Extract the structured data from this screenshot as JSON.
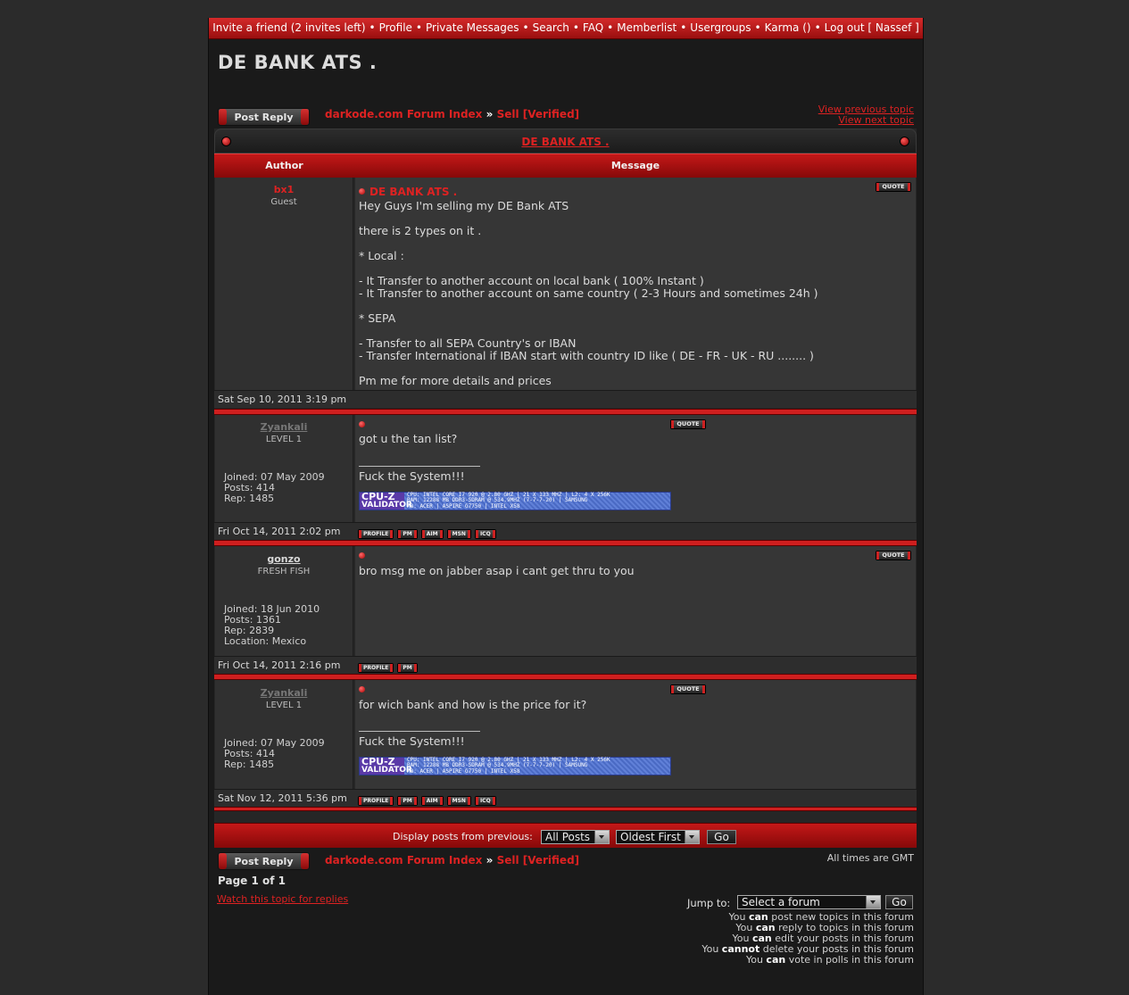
{
  "topnav": {
    "items": [
      "Invite a friend (2 invites left)",
      "Profile",
      "Private Messages",
      "Search",
      "FAQ",
      "Memberlist",
      "Usergroups",
      "Karma ()",
      "Log out [ Nassef ]"
    ],
    "separator": "•"
  },
  "page_title": "DE BANK ATS .",
  "post_reply_label": "Post Reply",
  "breadcrumb": {
    "forum_index": "darkode.com Forum Index",
    "sep": "»",
    "section": "Sell [Verified]"
  },
  "topic_nav": {
    "prev": "View previous topic",
    "next": "View next topic"
  },
  "table": {
    "title": "DE BANK ATS .",
    "col_author": "Author",
    "col_message": "Message"
  },
  "quote_label": "QUOTE",
  "posts": [
    {
      "author": "bx1",
      "rank": "Guest",
      "subject": "DE BANK ATS .",
      "body": "Hey Guys I'm selling my DE Bank ATS\n\nthere is 2 types on it .\n\n* Local :\n\n- It Transfer to another account on local bank ( 100% Instant )\n- It Transfer to another account on same country ( 2-3 Hours and sometimes 24h )\n\n* SEPA\n\n- Transfer to all SEPA Country's or IBAN\n- Transfer International if IBAN start with country ID like ( DE - FR - UK - RU ........ )\n\nPm me for more details and prices",
      "date": "Sat Sep 10, 2011 3:19 pm"
    },
    {
      "author": "Zyankali",
      "rank": "LEVEL 1",
      "info": [
        "Joined: 07 May 2009",
        "Posts: 414",
        "Rep: 1485"
      ],
      "body": "got u the tan list?",
      "signature": "Fuck the System!!!",
      "date": "Fri Oct 14, 2011 2:02 pm",
      "buttons": [
        "PROFILE",
        "PM",
        "AIM",
        "MSN",
        "ICQ"
      ]
    },
    {
      "author": "gonzo",
      "rank": "FRESH FISH",
      "info": [
        "Joined: 18 Jun 2010",
        "Posts: 1361",
        "Rep: 2839",
        "Location: Mexico"
      ],
      "body": "bro msg me on jabber asap i cant get thru to you",
      "date": "Fri Oct 14, 2011 2:16 pm",
      "buttons": [
        "PROFILE",
        "PM"
      ]
    },
    {
      "author": "Zyankali",
      "rank": "LEVEL 1",
      "info": [
        "Joined: 07 May 2009",
        "Posts: 414",
        "Rep: 1485"
      ],
      "body": "for wich bank and how is the price for it?",
      "signature": "Fuck the System!!!",
      "date": "Sat Nov 12, 2011 5:36 pm",
      "buttons": [
        "PROFILE",
        "PM",
        "AIM",
        "MSN",
        "ICQ"
      ]
    }
  ],
  "cpuz": {
    "logo_top": "CPU-Z",
    "logo_bottom": "VALIDATOR",
    "lines": [
      "CPU: INTEL CORE I7 920 @ 2.80 GHZ | 21 X 133 MHZ | L2: 4 X 256K",
      "RAM: 12288 MB DDR3-SDRAM @ 534.9MHZ (7-7-7-20) | SAMSUNG",
      "MB: ACER | ASPIRE G7750 | INTEL X58"
    ]
  },
  "display": {
    "label": "Display posts from previous:",
    "filter": "All Posts",
    "order": "Oldest First",
    "go": "Go"
  },
  "timezone": "All times are GMT",
  "pagination": "Page 1 of 1",
  "watch_link": "Watch this topic for replies",
  "jump": {
    "label": "Jump to:",
    "placeholder": "Select a forum",
    "go": "Go"
  },
  "permissions": [
    {
      "pre": "You ",
      "bold": "can",
      "post": " post new topics in this forum"
    },
    {
      "pre": "You ",
      "bold": "can",
      "post": " reply to topics in this forum"
    },
    {
      "pre": "You ",
      "bold": "can",
      "post": " edit your posts in this forum"
    },
    {
      "pre": "You ",
      "bold": "cannot",
      "post": " delete your posts in this forum"
    },
    {
      "pre": "You ",
      "bold": "can",
      "post": " vote in polls in this forum"
    }
  ]
}
